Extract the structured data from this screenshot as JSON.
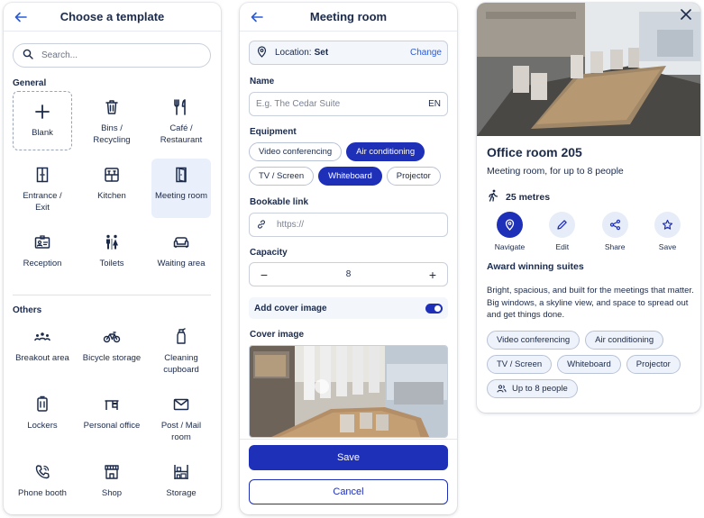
{
  "templates_panel": {
    "title": "Choose a template",
    "search_placeholder": "Search...",
    "general_label": "General",
    "general_items": [
      {
        "label": "Blank",
        "icon": "plus-icon"
      },
      {
        "label": "Bins /\nRecycling",
        "icon": "bin-icon"
      },
      {
        "label": "Café /\nRestaurant",
        "icon": "cutlery-icon"
      },
      {
        "label": "Entrance /\nExit",
        "icon": "door-icon"
      },
      {
        "label": "Kitchen",
        "icon": "fridge-icon"
      },
      {
        "label": "Meeting room",
        "icon": "meeting-door-icon",
        "selected": true
      },
      {
        "label": "Reception",
        "icon": "id-card-icon"
      },
      {
        "label": "Toilets",
        "icon": "toilets-icon"
      },
      {
        "label": "Waiting area",
        "icon": "sofa-icon"
      }
    ],
    "others_label": "Others",
    "other_items": [
      {
        "label": "Breakout area",
        "icon": "group-icon"
      },
      {
        "label": "Bicycle storage",
        "icon": "bicycle-icon"
      },
      {
        "label": "Cleaning\ncupboard",
        "icon": "spray-bottle-icon"
      },
      {
        "label": "Lockers",
        "icon": "locker-icon"
      },
      {
        "label": "Personal office",
        "icon": "desk-icon"
      },
      {
        "label": "Post / Mail\nroom",
        "icon": "mail-icon"
      },
      {
        "label": "Phone booth",
        "icon": "phone-icon"
      },
      {
        "label": "Shop",
        "icon": "shop-icon"
      },
      {
        "label": "Storage",
        "icon": "shelves-icon"
      }
    ]
  },
  "form_panel": {
    "title": "Meeting room",
    "location_key": "Location:",
    "location_value": "Set",
    "location_change": "Change",
    "name_label": "Name",
    "name_placeholder": "E.g. The Cedar Suite",
    "name_lang": "EN",
    "equipment_label": "Equipment",
    "equipment": [
      {
        "label": "Video conferencing",
        "on": false
      },
      {
        "label": "Air conditioning",
        "on": true
      },
      {
        "label": "TV / Screen",
        "on": false
      },
      {
        "label": "Whiteboard",
        "on": true
      },
      {
        "label": "Projector",
        "on": false
      }
    ],
    "link_label": "Bookable link",
    "link_placeholder": "https://",
    "capacity_label": "Capacity",
    "capacity_minus": "−",
    "capacity_value": "8",
    "capacity_plus": "+",
    "cover_toggle_label": "Add cover image",
    "cover_toggle_on": true,
    "cover_label": "Cover image",
    "save": "Save",
    "cancel": "Cancel"
  },
  "detail_panel": {
    "title": "Office room 205",
    "subtitle": "Meeting room, for up to 8 people",
    "distance": "25 metres",
    "actions": [
      {
        "label": "Navigate",
        "icon": "location-pin-icon",
        "active": true
      },
      {
        "label": "Edit",
        "icon": "pencil-icon",
        "active": false
      },
      {
        "label": "Share",
        "icon": "share-icon",
        "active": false
      },
      {
        "label": "Save",
        "icon": "star-icon",
        "active": false
      }
    ],
    "heading": "Award winning suites",
    "description": "Bright, spacious, and built for the meetings that matter. Big windows, a skyline view, and space to spread out and get things done.",
    "tags": [
      "Video conferencing",
      "Air conditioning",
      "TV / Screen",
      "Whiteboard",
      "Projector"
    ],
    "capacity_tag": "Up to 8 people"
  },
  "colors": {
    "primary": "#1e2fb8",
    "text": "#1b2a4a",
    "selected_bg": "#e9effb",
    "link": "#2a5bd7"
  }
}
